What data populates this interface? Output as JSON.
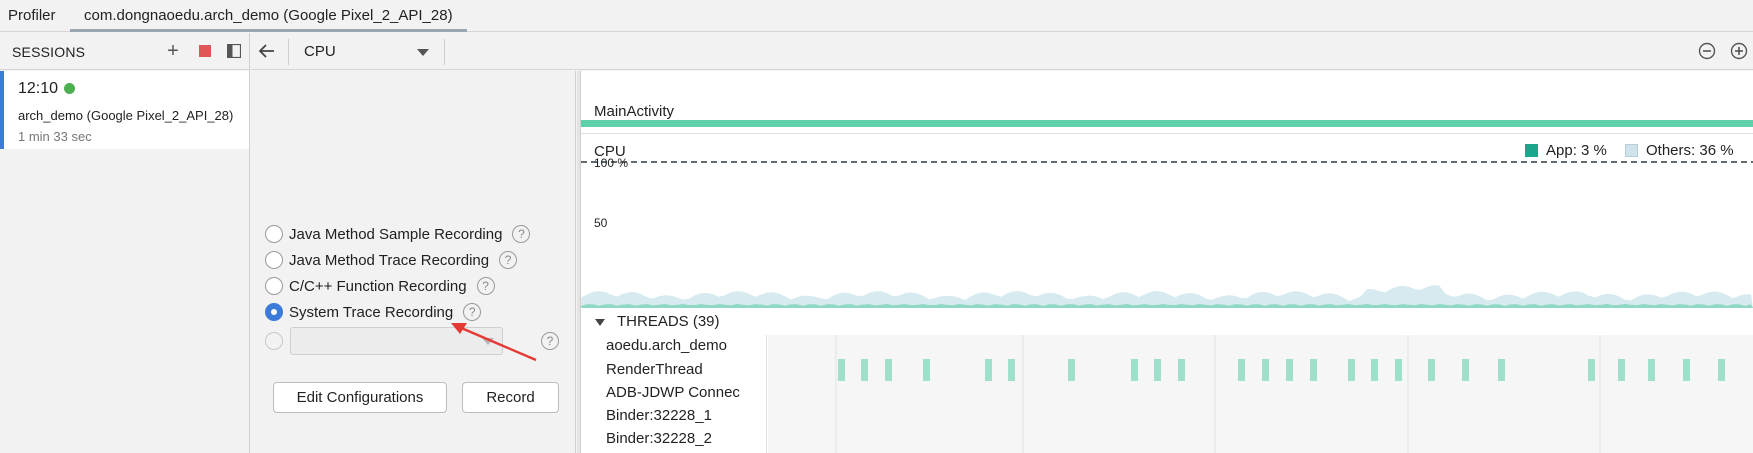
{
  "tabs": {
    "profiler": "Profiler",
    "session": "com.dongnaoedu.arch_demo (Google Pixel_2_API_28)"
  },
  "sessions": {
    "title": "SESSIONS",
    "current": {
      "time": "12:10",
      "name": "arch_demo (Google Pixel_2_API_28)",
      "duration": "1 min 33 sec"
    }
  },
  "toolbar": {
    "selected_profiler": "CPU"
  },
  "recording": {
    "options": [
      {
        "label": "Java Method Sample Recording",
        "selected": false
      },
      {
        "label": "Java Method Trace Recording",
        "selected": false
      },
      {
        "label": "C/C++ Function Recording",
        "selected": false
      },
      {
        "label": "System Trace Recording",
        "selected": true
      }
    ],
    "help_glyph": "?",
    "edit_button": "Edit Configurations",
    "record_button": "Record"
  },
  "timeline": {
    "activity": "MainActivity",
    "cpu_label": "CPU",
    "legend": [
      {
        "label": "App: 3 %",
        "color": "#1aa68a"
      },
      {
        "label": "Others: 36 %",
        "color": "#cfe3ea"
      }
    ],
    "ticks": [
      "100 %",
      "50"
    ],
    "threads_title": "THREADS (39)",
    "threads": [
      "aoedu.arch_demo",
      "RenderThread",
      "ADB-JDWP Connec",
      "Binder:32228_1",
      "Binder:32228_2"
    ]
  },
  "colors": {
    "accent": "#3d7bd9",
    "activity_bar": "#5fd0aa",
    "thread_state": "#9fe0cc",
    "annotation_arrow": "#e53935",
    "recording_dot": "#4caf50"
  }
}
